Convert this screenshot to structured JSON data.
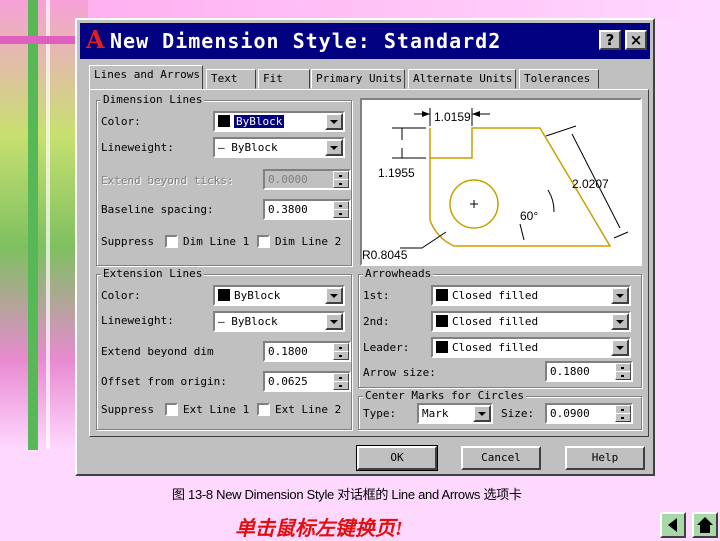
{
  "dialog": {
    "title": "New Dimension Style: Standard2",
    "help_btn": "?",
    "close_btn": "×"
  },
  "tabs": [
    {
      "label": "Lines and Arrows",
      "active": true
    },
    {
      "label": "Text"
    },
    {
      "label": "Fit"
    },
    {
      "label": "Primary Units"
    },
    {
      "label": "Alternate Units"
    },
    {
      "label": "Tolerances"
    }
  ],
  "dimension_lines": {
    "legend": "Dimension Lines",
    "color_label": "Color:",
    "color_value": "ByBlock",
    "lineweight_label": "Lineweight:",
    "lineweight_value": "— ByBlock",
    "extend_label": "Extend beyond ticks:",
    "extend_value": "0.0000",
    "baseline_label": "Baseline spacing:",
    "baseline_value": "0.3800",
    "suppress_label": "Suppress",
    "dim1_label": "Dim Line 1",
    "dim2_label": "Dim Line 2"
  },
  "preview": {
    "dim_top": "1.0159",
    "dim_left": "1.1955",
    "dim_right": "2.0207",
    "angle": "60°",
    "radius": "R0.8045"
  },
  "extension_lines": {
    "legend": "Extension Lines",
    "color_label": "Color:",
    "color_value": "ByBlock",
    "lineweight_label": "Lineweight:",
    "lineweight_value": "— ByBlock",
    "extend_label": "Extend beyond dim",
    "extend_value": "0.1800",
    "offset_label": "Offset from origin:",
    "offset_value": "0.0625",
    "suppress_label": "Suppress",
    "ext1_label": "Ext Line 1",
    "ext2_label": "Ext Line 2"
  },
  "arrowheads": {
    "legend": "Arrowheads",
    "first_label": "1st:",
    "first_value": "Closed filled",
    "second_label": "2nd:",
    "second_value": "Closed filled",
    "leader_label": "Leader:",
    "leader_value": "Closed filled",
    "size_label": "Arrow size:",
    "size_value": "0.1800"
  },
  "center_marks": {
    "legend": "Center Marks for Circles",
    "type_label": "Type:",
    "type_value": "Mark",
    "size_label": "Size:",
    "size_value": "0.0900"
  },
  "buttons": {
    "ok": "OK",
    "cancel": "Cancel",
    "help": "Help"
  },
  "slide": {
    "caption": "图 13-8   New Dimension Style 对话框的 Line and Arrows 选项卡",
    "nav_hint": "单击鼠标左键换页!",
    "nav_prev_icon": "back-arrow-icon",
    "nav_home_icon": "home-icon"
  }
}
